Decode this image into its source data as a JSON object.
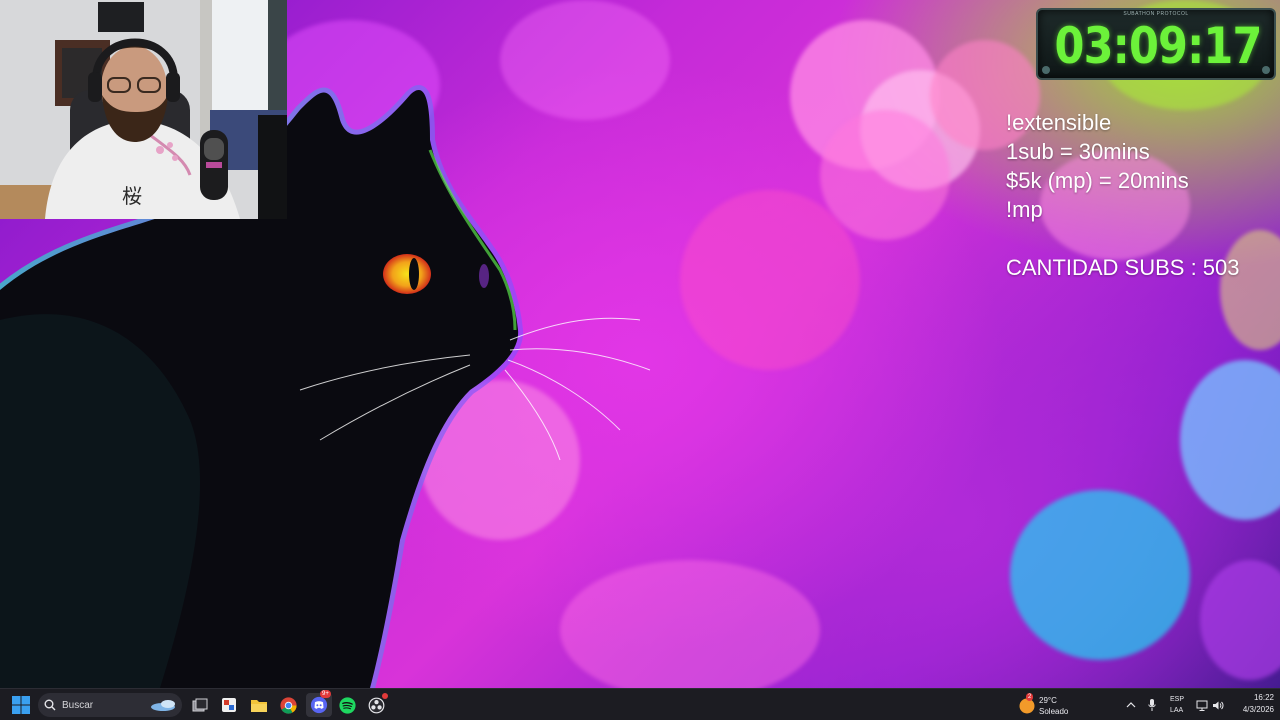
{
  "timer": {
    "caption": "SUBATHON PROTOCOL",
    "time": "03:09:17",
    "color": "#6cf23a"
  },
  "overlay": {
    "line1": "!extensible",
    "line2": "1sub = 30mins",
    "line3": "$5k (mp) = 20mins",
    "line4": "!mp",
    "subs_line": "CANTIDAD SUBS :  503"
  },
  "webcam": {
    "shirt_character": "桜"
  },
  "taskbar": {
    "search_placeholder": "Buscar",
    "pinned": [
      {
        "name": "start-button-icon"
      },
      {
        "name": "task-view-icon"
      },
      {
        "name": "image-editor-icon"
      },
      {
        "name": "file-explorer-icon"
      },
      {
        "name": "chrome-icon"
      },
      {
        "name": "discord-icon",
        "badge": "9+"
      },
      {
        "name": "spotify-icon"
      },
      {
        "name": "obs-icon"
      }
    ],
    "weather": {
      "badge": "2",
      "temp": "29°C",
      "condition": "Soleado"
    },
    "language": {
      "line1": "ESP",
      "line2": "LAA"
    },
    "clock": {
      "time": "16:22",
      "date": "4/3/2026"
    }
  }
}
